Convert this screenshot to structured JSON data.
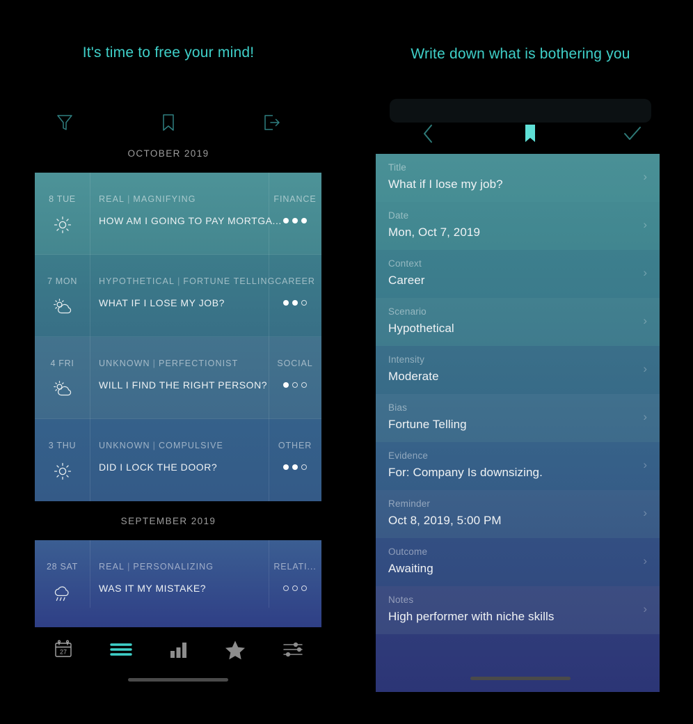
{
  "left_phone": {
    "header_title": "It's time to free your mind!",
    "toolbar": [
      {
        "name": "filter-icon",
        "label": "Filter"
      },
      {
        "name": "bookmark-icon",
        "label": "Bookmark"
      },
      {
        "name": "logout-icon",
        "label": "Log out"
      }
    ],
    "sections": [
      {
        "month": "OCTOBER 2019",
        "entries": [
          {
            "day": "8 TUE",
            "weather": "sun",
            "scenario": "REAL",
            "bias": "MAGNIFYING",
            "title": "HOW AM I GOING TO PAY MORTGA...",
            "category": "FINANCE",
            "intensity": 3
          },
          {
            "day": "7 MON",
            "weather": "partly-cloudy",
            "scenario": "HYPOTHETICAL",
            "bias": "FORTUNE TELLING",
            "title": "WHAT IF I LOSE MY JOB?",
            "category": "CAREER",
            "intensity": 2
          },
          {
            "day": "4 FRI",
            "weather": "partly-cloudy",
            "scenario": "UNKNOWN",
            "bias": "PERFECTIONIST",
            "title": "WILL I FIND THE RIGHT PERSON?",
            "category": "SOCIAL",
            "intensity": 1
          },
          {
            "day": "3 THU",
            "weather": "sun",
            "scenario": "UNKNOWN",
            "bias": "COMPULSIVE",
            "title": "DID I LOCK THE DOOR?",
            "category": "OTHER",
            "intensity": 2
          }
        ]
      },
      {
        "month": "SEPTEMBER 2019",
        "entries": [
          {
            "day": "28 SAT",
            "weather": "rain",
            "scenario": "REAL",
            "bias": "PERSONALIZING",
            "title": "WAS IT MY MISTAKE?",
            "category": "RELATI...",
            "intensity": 0
          }
        ]
      }
    ],
    "tabbar": [
      {
        "name": "calendar-tab-icon",
        "label": "Calendar",
        "badge": "27",
        "active": false
      },
      {
        "name": "list-tab-icon",
        "label": "List",
        "active": true
      },
      {
        "name": "stats-tab-icon",
        "label": "Statistics",
        "active": false
      },
      {
        "name": "favorites-tab-icon",
        "label": "Favorites",
        "active": false
      },
      {
        "name": "settings-tab-icon",
        "label": "Settings",
        "active": false
      }
    ],
    "separator": "|"
  },
  "right_phone": {
    "header_title": "Write down what is bothering you",
    "toolbar": [
      {
        "name": "back-icon",
        "label": "Back"
      },
      {
        "name": "bookmark-filled-icon",
        "label": "Bookmark"
      },
      {
        "name": "confirm-check-icon",
        "label": "Done"
      }
    ],
    "fields": [
      {
        "label": "Title",
        "value": "What if I lose my job?"
      },
      {
        "label": "Date",
        "value": "Mon, Oct 7, 2019"
      },
      {
        "label": "Context",
        "value": "Career"
      },
      {
        "label": "Scenario",
        "value": "Hypothetical"
      },
      {
        "label": "Intensity",
        "value": "Moderate"
      },
      {
        "label": "Bias",
        "value": "Fortune Telling"
      },
      {
        "label": "Evidence",
        "value": "For: Company Is downsizing."
      },
      {
        "label": "Reminder",
        "value": "Oct 8, 2019, 5:00 PM"
      },
      {
        "label": "Outcome",
        "value": "Awaiting"
      },
      {
        "label": "Notes",
        "value": "High performer with niche skills"
      }
    ],
    "chevron": "›"
  },
  "colors": {
    "accent_teal": "#3fd0c9",
    "background": "#000000",
    "row_gradient_top": "#4a9096",
    "row_gradient_bottom": "#2e3d7a",
    "detail_top": "#43898f",
    "detail_bottom": "#2b3576"
  }
}
